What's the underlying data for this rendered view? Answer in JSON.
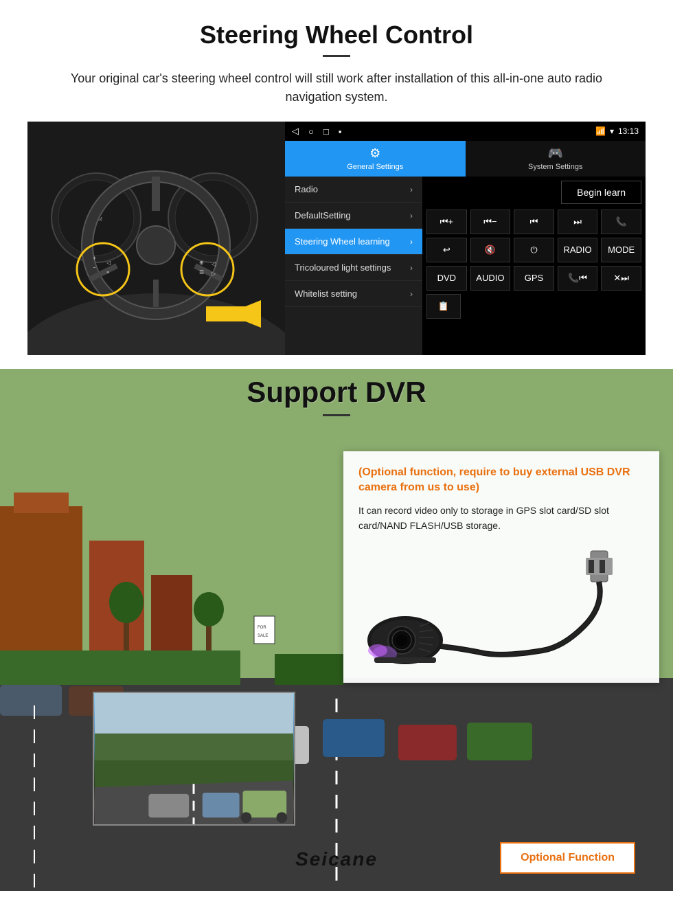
{
  "steering": {
    "title": "Steering Wheel Control",
    "subtitle": "Your original car's steering wheel control will still work after installation of this all-in-one auto radio navigation system.",
    "statusbar": {
      "time": "13:13",
      "icons": [
        "◁",
        "○",
        "□",
        "▪"
      ]
    },
    "tabs": [
      {
        "icon": "⚙",
        "label": "General Settings",
        "active": true
      },
      {
        "icon": "🎮",
        "label": "System Settings",
        "active": false
      }
    ],
    "menu_items": [
      {
        "label": "Radio",
        "active": false
      },
      {
        "label": "DefaultSetting",
        "active": false
      },
      {
        "label": "Steering Wheel learning",
        "active": true
      },
      {
        "label": "Tricoloured light settings",
        "active": false
      },
      {
        "label": "Whitelist setting",
        "active": false
      }
    ],
    "begin_learn": "Begin learn",
    "control_rows": [
      [
        "⏮+",
        "⏮−",
        "⏮⏮",
        "⏭⏭",
        "📞"
      ],
      [
        "↩",
        "🔇",
        "⏻",
        "RADIO",
        "MODE"
      ],
      [
        "DVD",
        "AUDIO",
        "GPS",
        "📞⏮",
        "✕⏭"
      ]
    ]
  },
  "dvr": {
    "title": "Support DVR",
    "info_title": "(Optional function, require to buy external USB DVR camera from us to use)",
    "info_text": "It can record video only to storage in GPS slot card/SD slot card/NAND FLASH/USB storage.",
    "optional_function_label": "Optional Function",
    "seicane_logo": "Seicane"
  }
}
